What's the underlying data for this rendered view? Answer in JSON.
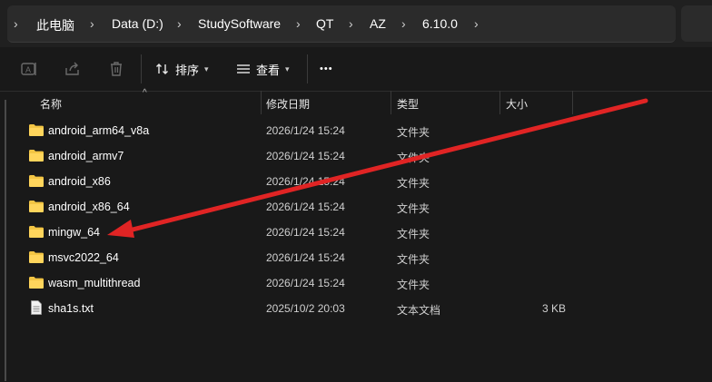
{
  "breadcrumb": {
    "items": [
      "此电脑",
      "Data (D:)",
      "StudySoftware",
      "QT",
      "AZ",
      "6.10.0"
    ]
  },
  "toolbar": {
    "sort_label": "排序",
    "view_label": "查看",
    "more_label": "•••"
  },
  "columns": {
    "name": "名称",
    "date": "修改日期",
    "type": "类型",
    "size": "大小"
  },
  "files": [
    {
      "name": "android_arm64_v8a",
      "date": "2026/1/24 15:24",
      "type": "文件夹",
      "size": "",
      "icon": "folder-icon"
    },
    {
      "name": "android_armv7",
      "date": "2026/1/24 15:24",
      "type": "文件夹",
      "size": "",
      "icon": "folder-icon"
    },
    {
      "name": "android_x86",
      "date": "2026/1/24 15:24",
      "type": "文件夹",
      "size": "",
      "icon": "folder-icon"
    },
    {
      "name": "android_x86_64",
      "date": "2026/1/24 15:24",
      "type": "文件夹",
      "size": "",
      "icon": "folder-icon"
    },
    {
      "name": "mingw_64",
      "date": "2026/1/24 15:24",
      "type": "文件夹",
      "size": "",
      "icon": "folder-icon"
    },
    {
      "name": "msvc2022_64",
      "date": "2026/1/24 15:24",
      "type": "文件夹",
      "size": "",
      "icon": "folder-icon"
    },
    {
      "name": "wasm_multithread",
      "date": "2026/1/24 15:24",
      "type": "文件夹",
      "size": "",
      "icon": "folder-icon"
    },
    {
      "name": "sha1s.txt",
      "date": "2025/10/2 20:03",
      "type": "文本文档",
      "size": "3 KB",
      "icon": "text-file-icon"
    }
  ],
  "colors": {
    "background": "#191919",
    "folder": "#f3c544",
    "annotation_arrow": "#e02424"
  }
}
